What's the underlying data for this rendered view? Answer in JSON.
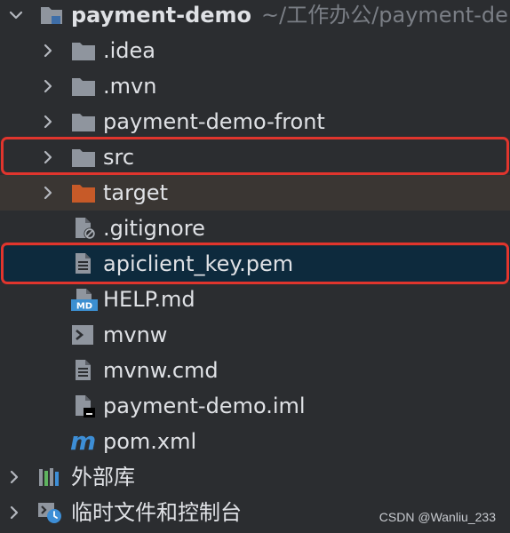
{
  "project": {
    "name": "payment-demo",
    "path": "~/工作办公/payment-de"
  },
  "tree": {
    "items": [
      {
        "label": ".idea"
      },
      {
        "label": ".mvn"
      },
      {
        "label": "payment-demo-front"
      },
      {
        "label": "src"
      },
      {
        "label": "target"
      },
      {
        "label": ".gitignore"
      },
      {
        "label": "apiclient_key.pem"
      },
      {
        "label": "HELP.md"
      },
      {
        "label": "mvnw"
      },
      {
        "label": "mvnw.cmd"
      },
      {
        "label": "payment-demo.iml"
      },
      {
        "label": "pom.xml"
      }
    ],
    "external_libraries": "外部库",
    "scratches": "临时文件和控制台"
  },
  "icons": {
    "md_badge": "MD",
    "maven": "m"
  },
  "watermark": "CSDN @Wanliu_233",
  "colors": {
    "background": "#2b2d30",
    "selected": "#0d2a3d",
    "highlight_border": "#e0352d",
    "excluded_folder": "#c75a28"
  }
}
